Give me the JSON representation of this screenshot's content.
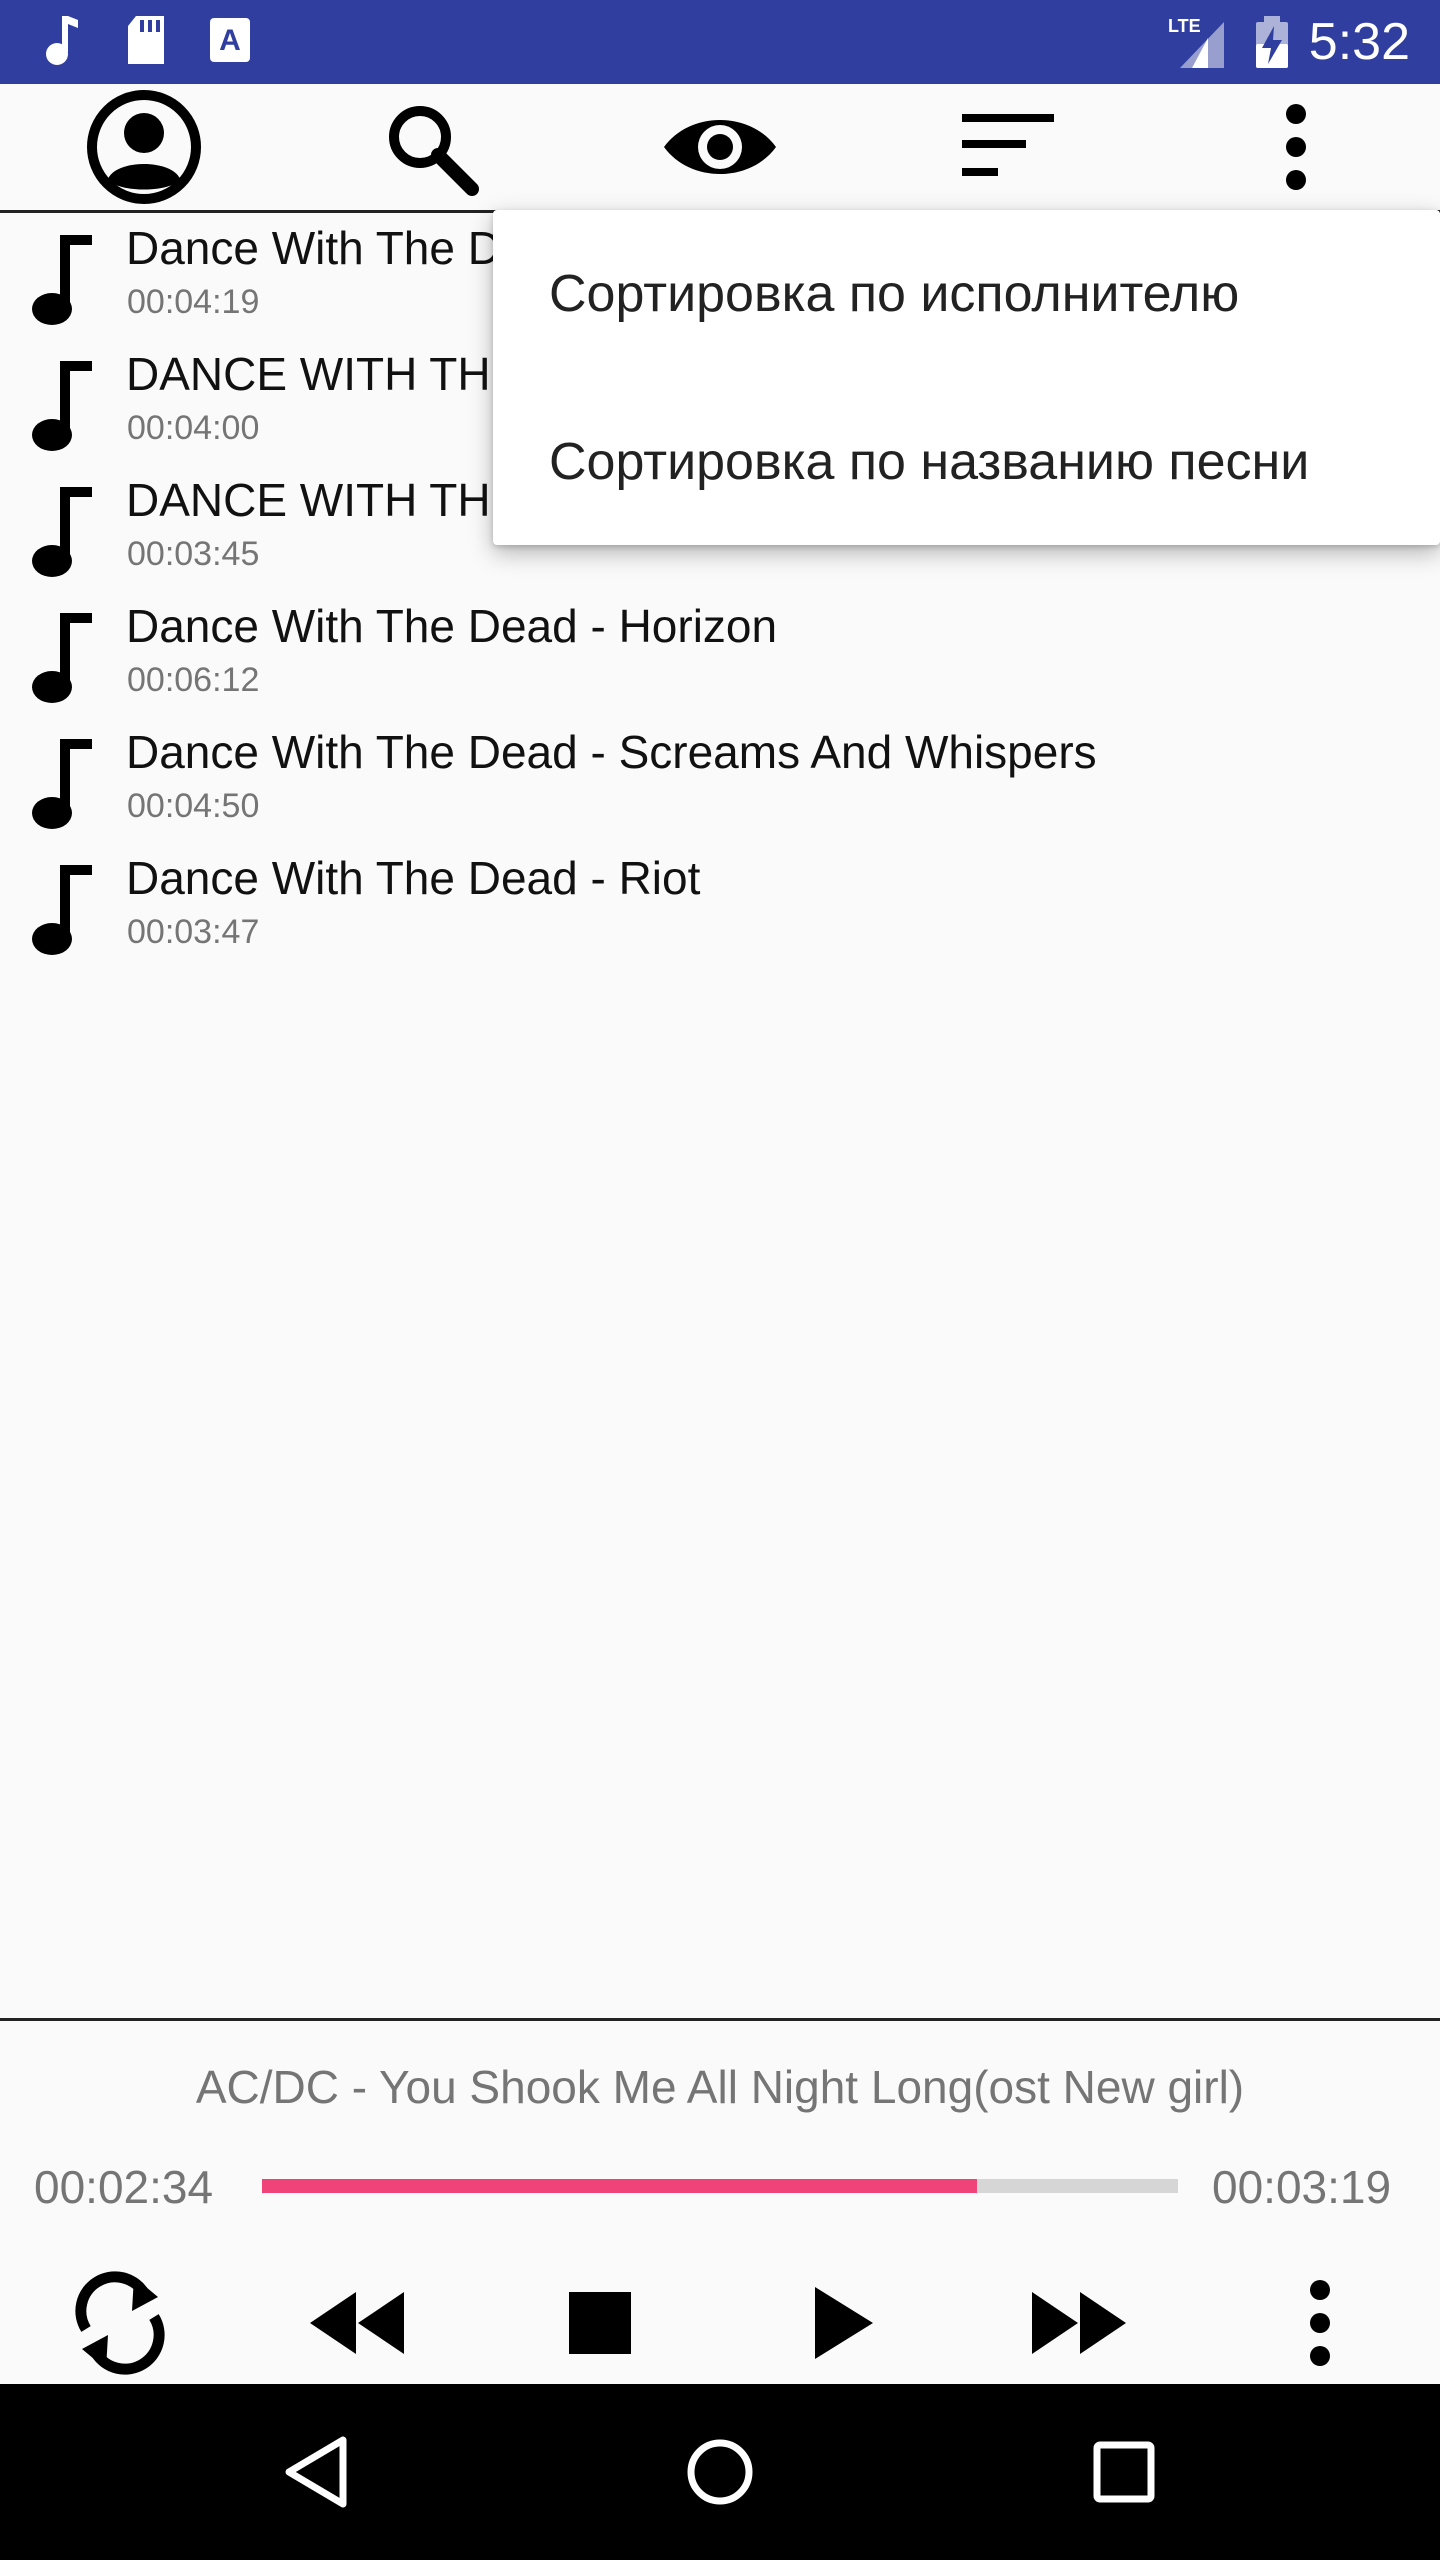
{
  "status_bar": {
    "time": "5:32",
    "icons": [
      "music-note-icon",
      "sd-card-icon",
      "text-a-icon",
      "lte-signal-icon",
      "battery-charging-icon"
    ],
    "network_label": "LTE"
  },
  "toolbar": {
    "buttons": [
      "account-icon",
      "search-icon",
      "eye-icon",
      "sort-icon",
      "more-vert-icon"
    ]
  },
  "tracks": [
    {
      "title": "Dance With The D",
      "duration": "00:04:19"
    },
    {
      "title": "DANCE WITH TH",
      "duration": "00:04:00"
    },
    {
      "title": "DANCE WITH TH",
      "duration": "00:03:45"
    },
    {
      "title": "Dance With The Dead - Horizon",
      "duration": "00:06:12"
    },
    {
      "title": "Dance With The Dead - Screams And Whispers",
      "duration": "00:04:50"
    },
    {
      "title": "Dance With The Dead - Riot",
      "duration": "00:03:47"
    }
  ],
  "sort_menu": {
    "items": [
      "Сортировка по исполнителю",
      "Сортировка по названию песни"
    ]
  },
  "player": {
    "now_playing": "AC/DC - You Shook Me All Night Long(ost New girl)",
    "elapsed": "00:02:34",
    "total": "00:03:19",
    "progress_fraction": 0.781,
    "accent_color": "#f0437a",
    "controls": [
      "repeat-icon",
      "rewind-icon",
      "stop-icon",
      "play-icon",
      "fast-forward-icon",
      "more-vert-icon"
    ]
  },
  "nav_bar": {
    "buttons": [
      "back-icon",
      "home-icon",
      "recents-icon"
    ]
  }
}
